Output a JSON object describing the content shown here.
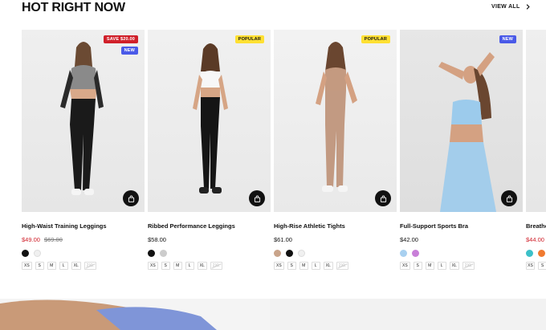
{
  "section": {
    "title": "HOT RIGHT NOW",
    "view_all": "VIEW ALL"
  },
  "products": [
    {
      "name": "High-Waist Training Leggings",
      "price": "$49.00",
      "old_price": "$69.00",
      "badges": [
        "SAVE $20.00",
        "NEW"
      ],
      "swatches": [
        "#111111",
        "#f0f0f0"
      ],
      "sizes": [
        "XS",
        "S",
        "M",
        "L",
        "XL",
        "2XL"
      ]
    },
    {
      "name": "Ribbed Performance Leggings",
      "price": "$58.00",
      "badges": [
        "POPULAR"
      ],
      "swatches": [
        "#111111",
        "#cccccc"
      ],
      "sizes": [
        "XS",
        "S",
        "M",
        "L",
        "XL",
        "2XL"
      ]
    },
    {
      "name": "High-Rise Athletic Tights",
      "price": "$61.00",
      "badges": [
        "POPULAR"
      ],
      "swatches": [
        "#c9a48a",
        "#111111",
        "#f0f0f0"
      ],
      "sizes": [
        "XS",
        "S",
        "M",
        "L",
        "XL",
        "2XL"
      ]
    },
    {
      "name": "Full-Support Sports Bra",
      "price": "$42.00",
      "badges": [
        "NEW"
      ],
      "swatches": [
        "#a8d0f0",
        "#c87fd8"
      ],
      "sizes": [
        "XS",
        "S",
        "M",
        "L",
        "XL",
        "2XL"
      ]
    },
    {
      "name": "Breathe",
      "price": "$44.00",
      "swatches": [
        "#3cc0c8",
        "#f07a30"
      ],
      "sizes": [
        "XS",
        "S"
      ]
    }
  ],
  "colors": {
    "sale_badge": "#d0202a",
    "new_badge": "#4a5ae8",
    "popular_badge": "#ffe033",
    "sale_price": "#d0202a"
  },
  "icons": {
    "view_all": "chevron-right-icon",
    "add_to_bag": "shopping-bag-icon"
  }
}
